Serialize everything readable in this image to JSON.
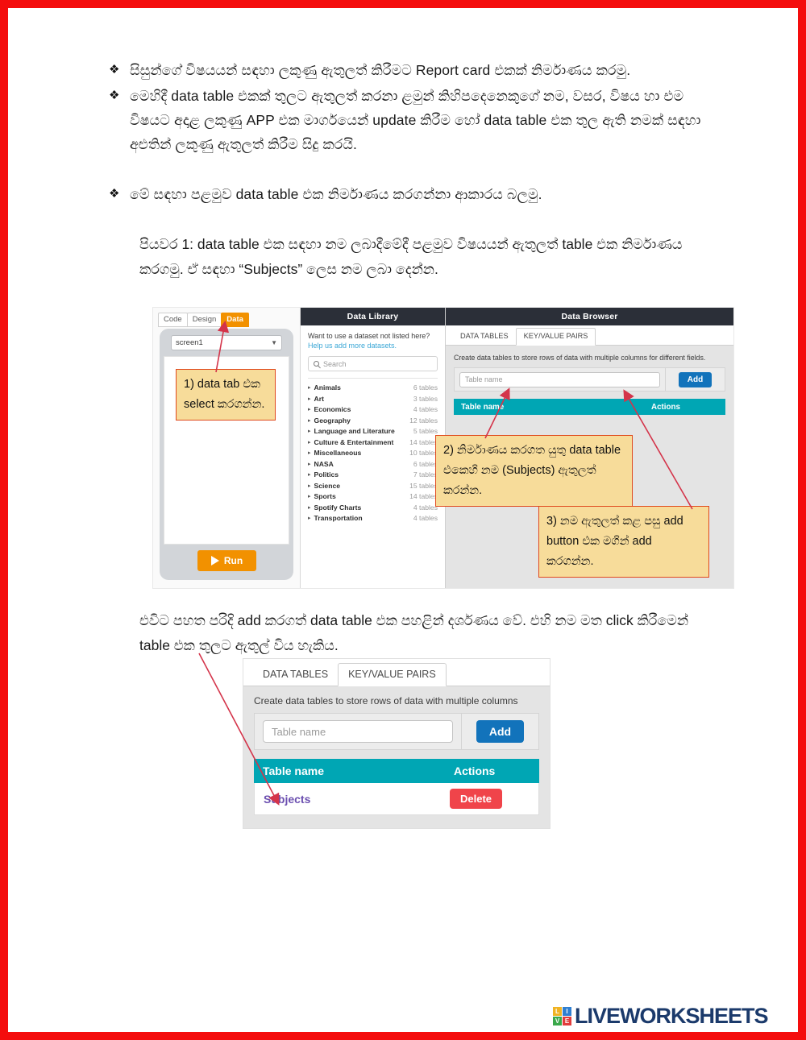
{
  "page": {
    "border_color": "#f40d0d",
    "bullet_glyph": "❖"
  },
  "document": {
    "bullets": [
      "සිසුන්ගේ විෂයයන් සඳහා ලකුණු ඇතුලත් කිරීමට Report card එකක් නිර්මාණය කරමු.",
      "මෙහිදී data table එකක් තුලට ඇතුලත් කරනා ළමුන් කිහිපදෙනෙකුගේ නම, වසර, විෂය හා එම විෂයට අදාළ ලකුණු APP එක මාර්ගයෙන් update කිරීම හෝ data table එක තුල ඇති නමක් සඳහා අළුතින් ලකුණු ඇතුලත් කිරීම සිදු කරයි.",
      "මේ සඳහා පළමුව data table එක නිර්මාණය කරගන්නා ආකාරය බලමු."
    ],
    "step1_paragraph": "පියවර 1: data table එක සඳහා නම ලබාදීමේදී පළමුව විෂයයන් ඇතුලත් table එක නිර්මාණය කරගමු. ඒ සඳහා “Subjects” ලෙස නම ලබා දෙන්න.",
    "after_paragraph": "එවිට පහත පරිදි add කරගත් data table එක පහළින් දර්ශණය වේ. එහි නම මත click කිරීමෙන් table එක තුලට ඇතුල් විය හැකිය."
  },
  "callouts": [
    {
      "id": "1",
      "text": "1)  data tab එක select කරගන්න."
    },
    {
      "id": "2",
      "text": "2)  නිර්මාණය කරගත යුතු data table එකෙහි නම (Subjects) ඇතුලත් කරන්න."
    },
    {
      "id": "3",
      "text": "3) නම ඇතුලත් කළ පසු add button එක මගින් add කරගන්න."
    }
  ],
  "top_shot": {
    "left_pane": {
      "tabs": [
        {
          "label": "Code",
          "active": false
        },
        {
          "label": "Design",
          "active": false
        },
        {
          "label": "Data",
          "active": true
        }
      ],
      "screen_select_value": "screen1",
      "run_label": "Run"
    },
    "data_library": {
      "header": "Data Library",
      "question": "Want to use a dataset not listed here?",
      "link": "Help us add more datasets.",
      "search_placeholder": "Search",
      "items": [
        {
          "name": "Animals",
          "count": "6 tables"
        },
        {
          "name": "Art",
          "count": "3 tables"
        },
        {
          "name": "Economics",
          "count": "4 tables"
        },
        {
          "name": "Geography",
          "count": "12 tables"
        },
        {
          "name": "Language and Literature",
          "count": "5 tables"
        },
        {
          "name": "Culture & Entertainment",
          "count": "14 tables"
        },
        {
          "name": "Miscellaneous",
          "count": "10 tables"
        },
        {
          "name": "NASA",
          "count": "6 tables"
        },
        {
          "name": "Politics",
          "count": "7 tables"
        },
        {
          "name": "Science",
          "count": "15 tables"
        },
        {
          "name": "Sports",
          "count": "14 tables"
        },
        {
          "name": "Spotify Charts",
          "count": "4 tables"
        },
        {
          "name": "Transportation",
          "count": "4 tables"
        }
      ]
    },
    "data_browser": {
      "header": "Data Browser",
      "tabs": [
        {
          "label": "DATA TABLES",
          "selected": true
        },
        {
          "label": "KEY/VALUE PAIRS",
          "selected": false
        }
      ],
      "description": "Create data tables to store rows of data with multiple columns for different fields.",
      "table_name_placeholder": "Table name",
      "add_label": "Add",
      "columns": {
        "name": "Table name",
        "actions": "Actions"
      }
    }
  },
  "bottom_shot": {
    "tabs": [
      {
        "label": "DATA TABLES",
        "selected": true
      },
      {
        "label": "KEY/VALUE PAIRS",
        "selected": false
      }
    ],
    "description": "Create data tables to store rows of data with multiple columns",
    "table_name_placeholder": "Table name",
    "add_label": "Add",
    "columns": {
      "name": "Table name",
      "actions": "Actions"
    },
    "rows": [
      {
        "name": "Subjects",
        "action": "Delete"
      }
    ]
  },
  "footer": {
    "logo_letters": [
      "L",
      "I",
      "V",
      "E"
    ],
    "logo_colors": [
      "#f0b323",
      "#2f7fd1",
      "#3aa84b",
      "#e23c3c"
    ],
    "wordmark": "LIVEWORKSHEETS"
  },
  "colors": {
    "accent_orange": "#f29100",
    "teal": "#00a6b4",
    "blue": "#1273bb",
    "red": "#f0444a",
    "callout_bg": "#f7dc9a",
    "callout_border": "#e04a1e",
    "arrow": "#d4344a"
  }
}
